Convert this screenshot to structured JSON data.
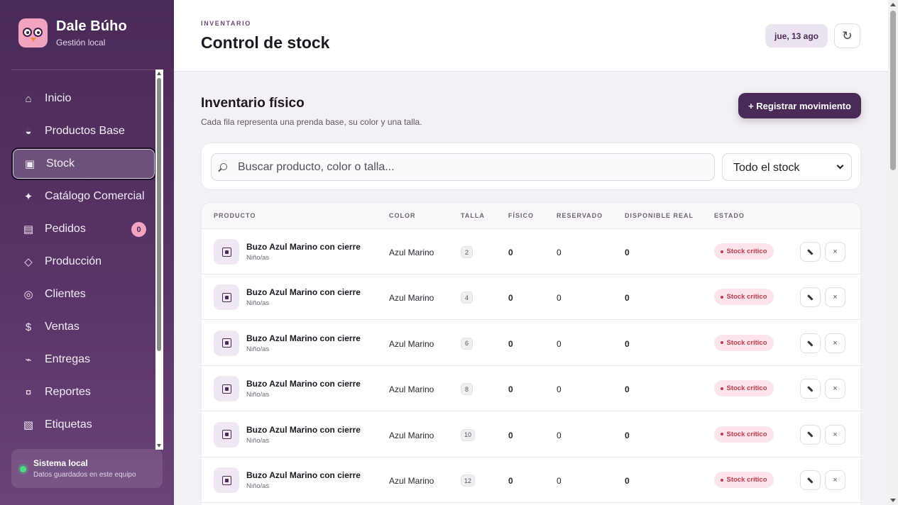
{
  "brand": {
    "name": "Dale Búho",
    "subtitle": "Gestión local"
  },
  "sidebar": {
    "items": [
      {
        "label": "Inicio",
        "icon": "home-icon",
        "glyph": "⌂"
      },
      {
        "label": "Productos Base",
        "icon": "half-circle-icon",
        "glyph": "◒"
      },
      {
        "label": "Stock",
        "icon": "box-icon",
        "glyph": "▣",
        "active": true
      },
      {
        "label": "Catálogo Comercial",
        "icon": "sparkle-icon",
        "glyph": "✦"
      },
      {
        "label": "Pedidos",
        "icon": "list-icon",
        "glyph": "▤",
        "badge": "0"
      },
      {
        "label": "Producción",
        "icon": "diamond-icon",
        "glyph": "◇"
      },
      {
        "label": "Clientes",
        "icon": "target-icon",
        "glyph": "◎"
      },
      {
        "label": "Ventas",
        "icon": "dollar-icon",
        "glyph": "$"
      },
      {
        "label": "Entregas",
        "icon": "route-icon",
        "glyph": "⌁"
      },
      {
        "label": "Reportes",
        "icon": "report-icon",
        "glyph": "¤"
      },
      {
        "label": "Etiquetas",
        "icon": "tag-icon",
        "glyph": "▧"
      }
    ],
    "status": {
      "title": "Sistema local",
      "subtitle": "Datos guardados en este equipo"
    }
  },
  "header": {
    "eyebrow": "INVENTARIO",
    "title": "Control de stock",
    "date": "jue, 13 ago",
    "refresh_glyph": "↻"
  },
  "section": {
    "title": "Inventario físico",
    "subtitle": "Cada fila representa una prenda base, su color y una talla.",
    "primary_button": "+ Registrar movimiento"
  },
  "filters": {
    "search_placeholder": "Buscar producto, color o talla...",
    "select_value": "Todo el stock"
  },
  "table": {
    "columns": [
      "PRODUCTO",
      "COLOR",
      "TALLA",
      "FÍSICO",
      "RESERVADO",
      "DISPONIBLE REAL",
      "ESTADO"
    ],
    "rows": [
      {
        "product": "Buzo Azul Marino con cierre",
        "category": "Niño/as",
        "color": "Azul Marino",
        "size": "2",
        "fisico": "0",
        "reservado": "0",
        "disponible": "0",
        "estado": "Stock crítico"
      },
      {
        "product": "Buzo Azul Marino con cierre",
        "category": "Niño/as",
        "color": "Azul Marino",
        "size": "4",
        "fisico": "0",
        "reservado": "0",
        "disponible": "0",
        "estado": "Stock crítico"
      },
      {
        "product": "Buzo Azul Marino con cierre",
        "category": "Niño/as",
        "color": "Azul Marino",
        "size": "6",
        "fisico": "0",
        "reservado": "0",
        "disponible": "0",
        "estado": "Stock crítico"
      },
      {
        "product": "Buzo Azul Marino con cierre",
        "category": "Niño/as",
        "color": "Azul Marino",
        "size": "8",
        "fisico": "0",
        "reservado": "0",
        "disponible": "0",
        "estado": "Stock crítico"
      },
      {
        "product": "Buzo Azul Marino con cierre",
        "category": "Niño/as",
        "color": "Azul Marino",
        "size": "10",
        "fisico": "0",
        "reservado": "0",
        "disponible": "0",
        "estado": "Stock crítico"
      },
      {
        "product": "Buzo Azul Marino con cierre",
        "category": "Niño/as",
        "color": "Azul Marino",
        "size": "12",
        "fisico": "0",
        "reservado": "0",
        "disponible": "0",
        "estado": "Stock crítico"
      }
    ],
    "actions": {
      "edit_icon": "pencil-icon",
      "delete_glyph": "×"
    }
  },
  "colors": {
    "brand": "#4a2a57",
    "accent_pink": "#f2a3c0",
    "critical": "#c0394f",
    "online": "#4ade80"
  }
}
